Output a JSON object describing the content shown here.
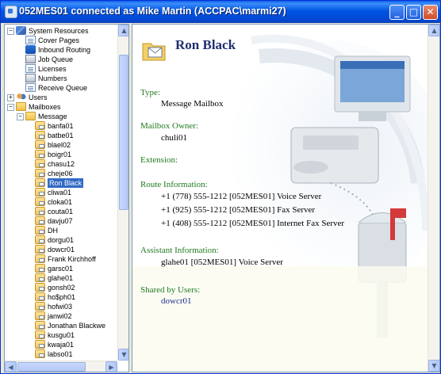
{
  "window": {
    "title": "052MES01 connected as Mike Martin (ACCPAC\\marmi27)",
    "controls": {
      "minimize": "_",
      "maximize": "□",
      "close": "✕"
    }
  },
  "tree": {
    "nodes": [
      {
        "label": "System Resources",
        "expander": "−",
        "icon": "system-resources-icon"
      },
      {
        "label": "Cover Pages",
        "icon": "page-icon"
      },
      {
        "label": "Inbound Routing",
        "icon": "routing-icon"
      },
      {
        "label": "Job Queue",
        "icon": "queue-icon"
      },
      {
        "label": "Licenses",
        "icon": "page-icon"
      },
      {
        "label": "Numbers",
        "icon": "queue-icon"
      },
      {
        "label": "Receive Queue",
        "icon": "page-icon"
      },
      {
        "label": "Users",
        "expander": "+",
        "icon": "users-icon"
      },
      {
        "label": "Mailboxes",
        "expander": "−",
        "icon": "folder-icon"
      },
      {
        "label": "Message",
        "expander": "−",
        "icon": "message-folder-icon"
      },
      {
        "label": "banfa01",
        "icon": "mailbox-icon"
      },
      {
        "label": "batbe01",
        "icon": "mailbox-icon"
      },
      {
        "label": "blael02",
        "icon": "mailbox-icon"
      },
      {
        "label": "boigr01",
        "icon": "mailbox-icon"
      },
      {
        "label": "chasu12",
        "icon": "mailbox-icon"
      },
      {
        "label": "cheje06",
        "icon": "mailbox-icon"
      },
      {
        "label": "Ron Black",
        "icon": "mailbox-icon",
        "selected": true
      },
      {
        "label": "cliwa01",
        "icon": "mailbox-icon"
      },
      {
        "label": "cloka01",
        "icon": "mailbox-icon"
      },
      {
        "label": "couta01",
        "icon": "mailbox-icon"
      },
      {
        "label": "davju07",
        "icon": "mailbox-icon"
      },
      {
        "label": "DH",
        "icon": "mailbox-icon"
      },
      {
        "label": "dorgu01",
        "icon": "mailbox-icon"
      },
      {
        "label": "dowcr01",
        "icon": "mailbox-icon"
      },
      {
        "label": "Frank Kirchhoff",
        "icon": "mailbox-icon"
      },
      {
        "label": "garsc01",
        "icon": "mailbox-icon"
      },
      {
        "label": "glahe01",
        "icon": "mailbox-icon"
      },
      {
        "label": "gonsh02",
        "icon": "mailbox-icon"
      },
      {
        "label": "ho$ph01",
        "icon": "mailbox-icon"
      },
      {
        "label": "hofwi03",
        "icon": "mailbox-icon"
      },
      {
        "label": "janwi02",
        "icon": "mailbox-icon"
      },
      {
        "label": "Jonathan Blackwe",
        "icon": "mailbox-icon"
      },
      {
        "label": "kusgu01",
        "icon": "mailbox-icon"
      },
      {
        "label": "kwaja01",
        "icon": "mailbox-icon"
      },
      {
        "label": "labso01",
        "icon": "mailbox-icon"
      }
    ]
  },
  "scroll_glyphs": {
    "up": "▲",
    "down": "▼",
    "left": "◀",
    "right": "▶"
  },
  "detail": {
    "name": "Ron Black",
    "type_label": "Type:",
    "type_value": "Message Mailbox",
    "owner_label": "Mailbox Owner:",
    "owner_value": "chuli01",
    "extension_label": "Extension:",
    "route_label": "Route Information:",
    "routes": [
      "+1 (778) 555-1212 [052MES01] Voice Server",
      "+1 (925) 555-1212 [052MES01] Fax Server",
      "+1 (408) 555-1212 [052MES01] Internet Fax Server"
    ],
    "assistant_label": "Assistant Information:",
    "assistant_value": "glahe01 [052MES01] Voice Server",
    "shared_label": "Shared by Users:",
    "shared_value": "dowcr01"
  },
  "colors": {
    "titlebar": "#0055e5",
    "selection": "#316ac5",
    "field_label": "#1f7a1f",
    "heading": "#1f2f6e"
  }
}
